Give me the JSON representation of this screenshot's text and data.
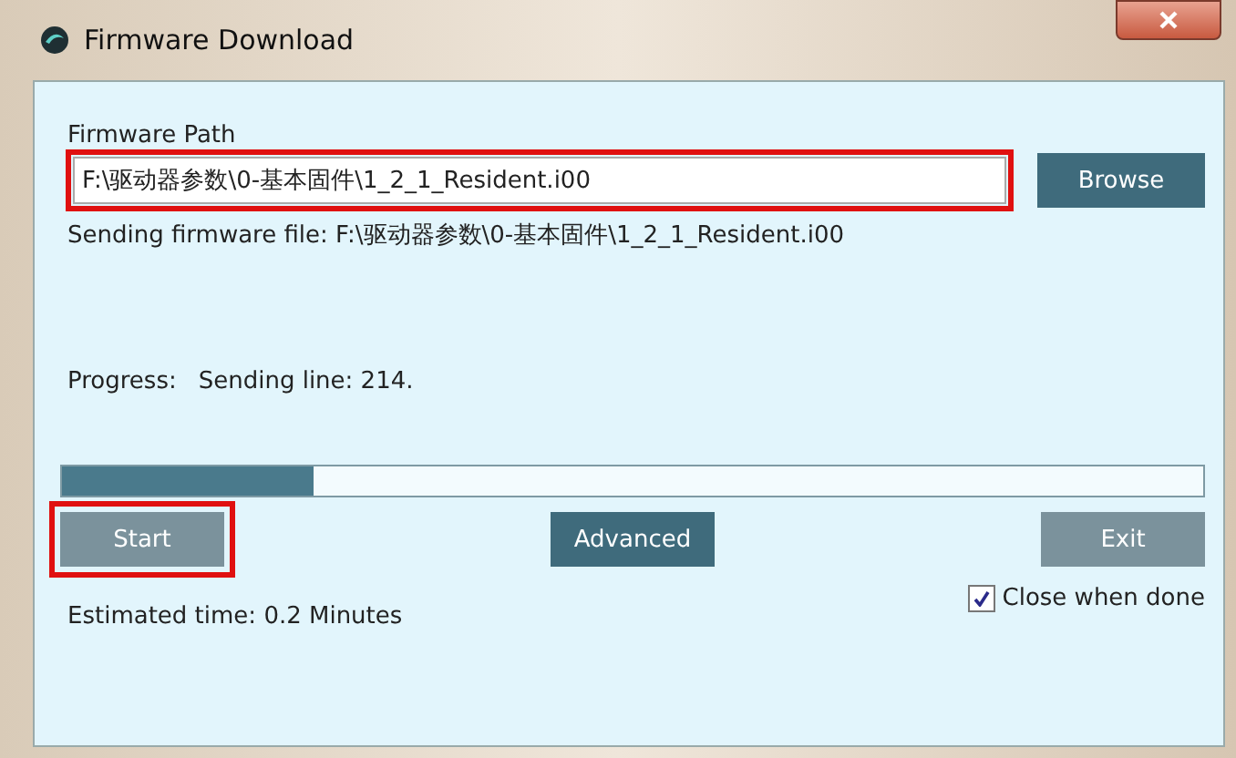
{
  "window": {
    "title": "Firmware Download"
  },
  "path_field": {
    "label": "Firmware Path",
    "value": "F:\\驱动器参数\\0-基本固件\\1_2_1_Resident.i00",
    "highlighted": true
  },
  "browse_button": {
    "label": "Browse",
    "disabled": false
  },
  "sending_text": "Sending firmware file: F:\\驱动器参数\\0-基本固件\\1_2_1_Resident.i00",
  "progress": {
    "label": "Progress:",
    "status": "Sending line: 214.",
    "level": 0.22
  },
  "buttons": [
    {
      "label": "Start",
      "disabled": true,
      "highlighted": true
    },
    {
      "label": "Advanced",
      "disabled": false,
      "highlighted": false
    },
    {
      "label": "Exit",
      "disabled": true,
      "highlighted": false
    }
  ],
  "estimated_time": "Estimated time: 0.2 Minutes",
  "close_when_done": {
    "label": "Close when done",
    "checked": true
  }
}
